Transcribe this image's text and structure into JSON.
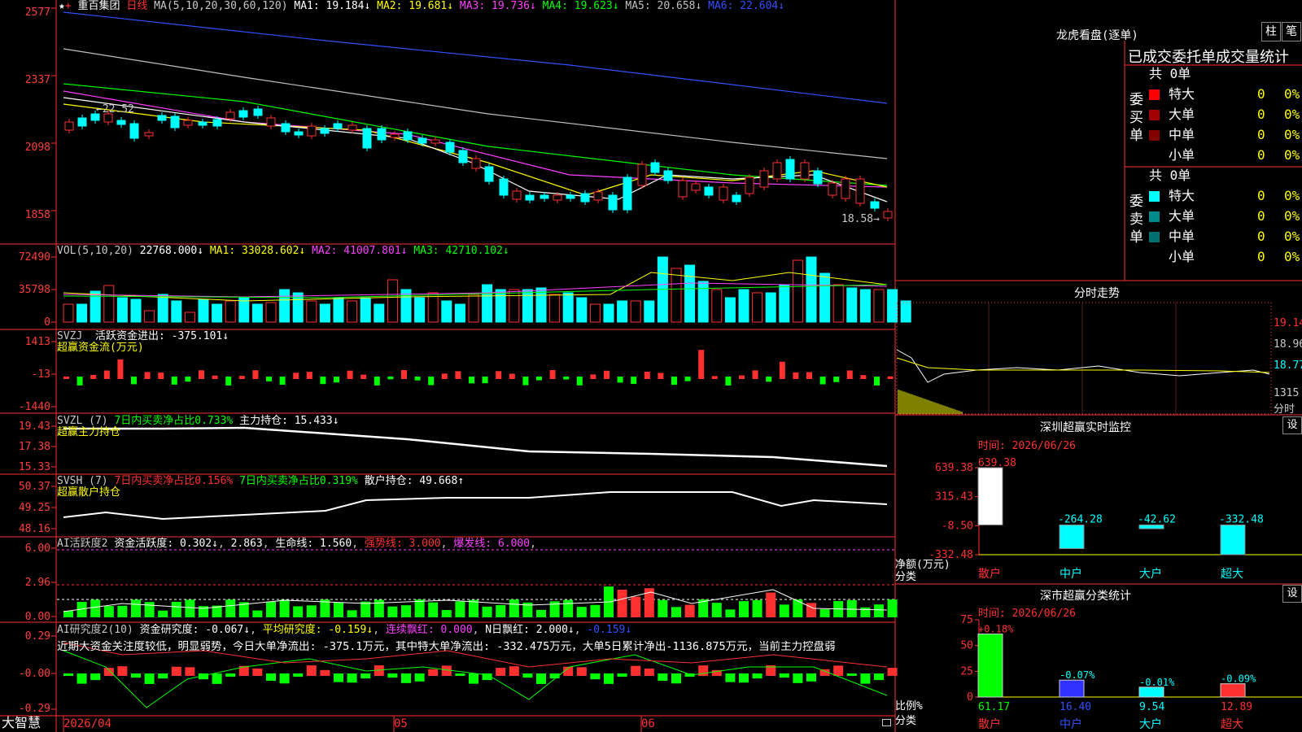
{
  "title_bar": {
    "stock_name": "重百集团",
    "period": "日线",
    "ma_params": "MA(5,10,20,30,60,120)",
    "ma_values": [
      {
        "label": "MA1: 19.184↓",
        "color": "#ffffff"
      },
      {
        "label": "MA2: 19.681↓",
        "color": "#ffff00"
      },
      {
        "label": "MA3: 19.736↓",
        "color": "#ff40ff"
      },
      {
        "label": "MA4: 19.623↓",
        "color": "#00ff00"
      },
      {
        "label": "MA5: 20.658↓",
        "color": "#c0c0c0"
      },
      {
        "label": "MA6: 22.604↓",
        "color": "#3050ff"
      }
    ]
  },
  "price_axis": [
    "2577",
    "2337",
    "2098",
    "1858"
  ],
  "price_annotations": {
    "high": "22.52",
    "low": "18.58"
  },
  "vol_pane": {
    "header": "VOL(5,10,20)",
    "value": "22768.000↓",
    "ma1": "MA1: 33028.602↓",
    "ma2": "MA2: 41007.801↓",
    "ma3": "MA3: 42710.102↓",
    "axis": [
      "72490",
      "35798",
      "0"
    ]
  },
  "svzj_pane": {
    "header": "SVZJ",
    "label1": "活跃资金进出: -375.101↓",
    "label2": "超赢资金流(万元)",
    "axis": [
      "1413",
      "-13",
      "-1440"
    ]
  },
  "svzl_pane": {
    "header": "SVZL (7)",
    "label1": "7日内买卖净占比0.733%",
    "label2": "主力持仓: 15.433↓",
    "label3": "超赢主力持仓",
    "axis": [
      "19.43",
      "17.38",
      "15.33"
    ]
  },
  "svsh_pane": {
    "header": "SVSH (7)",
    "label1": "7日内买卖净占比0.156%",
    "label2": "7日内买卖净占比0.319%",
    "label3": "散户持仓: 49.668↑",
    "label4": "超赢散户持仓",
    "axis": [
      "50.37",
      "49.25",
      "48.16"
    ]
  },
  "ai_active_pane": {
    "header": "AI活跃度2",
    "label1": "资金活跃度: 0.302↓",
    "label2": "2.863",
    "label3": "生命线: 1.560",
    "label4": "强势线: 3.000",
    "label5": "爆发线: 6.000",
    "axis": [
      "6.00",
      "2.96",
      "0.00"
    ]
  },
  "ai_research_pane": {
    "header": "AI研究度2(10)",
    "label1": "资金研究度: -0.067↓",
    "label2": "平均研究度: -0.159↓",
    "label3": "连续飘红: 0.000",
    "label4": "N日飘红: 2.000↓",
    "label5": "-0.159↓",
    "commentary": "近期大资金关注度较低，明显弱势，今日大单净流出: -375.1万元，其中特大单净流出: -332.475万元，大单5日累计净出-1136.875万元，当前主力控盘弱",
    "axis": [
      "0.29",
      "-0.00",
      "-0.29"
    ]
  },
  "date_axis": [
    "2026/04",
    "05",
    "06"
  ],
  "brand": "大智慧",
  "right_panel": {
    "dragon_title": "龙虎看盘(逐单)",
    "btn_column": "柱",
    "btn_pen": "笔",
    "tabs_text": "已成交委托单成交量统计",
    "buy_section": {
      "side_label": "委买单",
      "total": "共 0单",
      "rows": [
        {
          "name": "特大",
          "count": "0",
          "pct": "0%",
          "color": "#ff0000"
        },
        {
          "name": "大单",
          "count": "0",
          "pct": "0%",
          "color": "#a00000"
        },
        {
          "name": "中单",
          "count": "0",
          "pct": "0%",
          "color": "#800000"
        },
        {
          "name": "小单",
          "count": "0",
          "pct": "0%",
          "color": ""
        }
      ]
    },
    "sell_section": {
      "side_label": "委卖单",
      "total": "共 0单",
      "rows": [
        {
          "name": "特大",
          "count": "0",
          "pct": "0%",
          "color": "#00ffff"
        },
        {
          "name": "大单",
          "count": "0",
          "pct": "0%",
          "color": "#008b8b"
        },
        {
          "name": "中单",
          "count": "0",
          "pct": "0%",
          "color": "#007070"
        },
        {
          "name": "小单",
          "count": "0",
          "pct": "0%",
          "color": ""
        }
      ]
    },
    "intraday": {
      "title": "分时走势",
      "price_axis": [
        "19.14",
        "18.96",
        "18.77"
      ],
      "vol_axis": "1315",
      "vol_label": "分时"
    },
    "sz_monitor": {
      "title": "深圳超赢实时监控",
      "set_btn": "设",
      "time_label": "时间: 2026/06/26",
      "y_axis": [
        "639.38",
        "315.43",
        "-8.50",
        "-332.48"
      ],
      "ylabel": "净额(万元)",
      "xlabel": "分类",
      "bars": [
        {
          "cat": "散户",
          "value": 639.38,
          "label": "639.38",
          "color": "#ffffff"
        },
        {
          "cat": "中户",
          "value": -264.28,
          "label": "-264.28",
          "color": "#00ffff"
        },
        {
          "cat": "大户",
          "value": -42.62,
          "label": "-42.62",
          "color": "#00ffff"
        },
        {
          "cat": "超大",
          "value": -332.48,
          "label": "-332.48",
          "color": "#00ffff"
        }
      ]
    },
    "sz_classify": {
      "title": "深市超赢分类统计",
      "set_btn": "设",
      "time_label": "时间: 2026/06/26",
      "y_axis": [
        "75",
        "50",
        "25",
        "0"
      ],
      "ylabel": "比例%",
      "xlabel": "分类",
      "bars": [
        {
          "cat": "散户",
          "value": 61.17,
          "label": "61.17",
          "change": "+0.18%",
          "color": "#00ff00"
        },
        {
          "cat": "中户",
          "value": 16.4,
          "label": "16.40",
          "change": "-0.07%",
          "color": "#3030ff"
        },
        {
          "cat": "大户",
          "value": 9.54,
          "label": "9.54",
          "change": "-0.01%",
          "color": "#00ffff"
        },
        {
          "cat": "超大",
          "value": 12.89,
          "label": "12.89",
          "change": "-0.09%",
          "color": "#ff3030"
        }
      ]
    }
  }
}
